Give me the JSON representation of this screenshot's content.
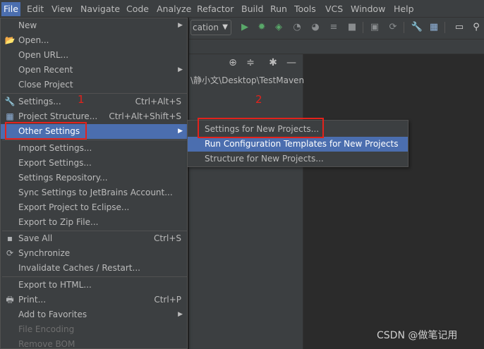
{
  "menubar": {
    "items": [
      "File",
      "Edit",
      "View",
      "Navigate",
      "Code",
      "Analyze",
      "Refactor",
      "Build",
      "Run",
      "Tools",
      "VCS",
      "Window",
      "Help"
    ]
  },
  "toolbar": {
    "run_config": "cation",
    "icons": [
      "run-icon",
      "debug-icon",
      "coverage-icon",
      "profile-icon",
      "attach-icon",
      "step-icon",
      "stop-icon",
      "build-icon",
      "sync-icon",
      "settings-wrench-icon",
      "project-structure-icon",
      "window-icon",
      "search-icon"
    ]
  },
  "project_panel": {
    "path": "\\静小文\\Desktop\\TestMaven"
  },
  "file_menu": {
    "items": [
      {
        "label": "New",
        "icon": "",
        "shortcut": "",
        "arrow": true
      },
      {
        "label": "Open...",
        "icon": "folder-icon",
        "shortcut": "",
        "arrow": false
      },
      {
        "label": "Open URL...",
        "icon": "",
        "shortcut": "",
        "arrow": false
      },
      {
        "label": "Open Recent",
        "icon": "",
        "shortcut": "",
        "arrow": true
      },
      {
        "label": "Close Project",
        "icon": "",
        "shortcut": "",
        "arrow": false
      },
      {
        "label": "Settings...",
        "icon": "wrench-icon",
        "shortcut": "Ctrl+Alt+S",
        "arrow": false
      },
      {
        "label": "Project Structure...",
        "icon": "project-structure-icon",
        "shortcut": "Ctrl+Alt+Shift+S",
        "arrow": false
      },
      {
        "label": "Other Settings",
        "icon": "",
        "shortcut": "",
        "arrow": true
      },
      {
        "label": "Import Settings...",
        "icon": "",
        "shortcut": "",
        "arrow": false
      },
      {
        "label": "Export Settings...",
        "icon": "",
        "shortcut": "",
        "arrow": false
      },
      {
        "label": "Settings Repository...",
        "icon": "",
        "shortcut": "",
        "arrow": false
      },
      {
        "label": "Sync Settings to JetBrains Account...",
        "icon": "",
        "shortcut": "",
        "arrow": false
      },
      {
        "label": "Export Project to Eclipse...",
        "icon": "",
        "shortcut": "",
        "arrow": false
      },
      {
        "label": "Export to Zip File...",
        "icon": "",
        "shortcut": "",
        "arrow": false
      },
      {
        "label": "Save All",
        "icon": "save-icon",
        "shortcut": "Ctrl+S",
        "arrow": false
      },
      {
        "label": "Synchronize",
        "icon": "synchronize-icon",
        "shortcut": "",
        "arrow": false
      },
      {
        "label": "Invalidate Caches / Restart...",
        "icon": "",
        "shortcut": "",
        "arrow": false
      },
      {
        "label": "Export to HTML...",
        "icon": "",
        "shortcut": "",
        "arrow": false
      },
      {
        "label": "Print...",
        "icon": "print-icon",
        "shortcut": "Ctrl+P",
        "arrow": false
      },
      {
        "label": "Add to Favorites",
        "icon": "",
        "shortcut": "",
        "arrow": true
      },
      {
        "label": "File Encoding",
        "icon": "",
        "shortcut": "",
        "arrow": false
      },
      {
        "label": "Remove BOM",
        "icon": "",
        "shortcut": "",
        "arrow": false
      }
    ]
  },
  "other_settings_submenu": {
    "items": [
      "Settings for New Projects...",
      "Run Configuration Templates for New Projects",
      "Structure for New Projects..."
    ]
  },
  "annotations": {
    "step1": "1",
    "step2": "2"
  },
  "watermark": "CSDN @做笔记用",
  "colors": {
    "menu_bg": "#3c3f41",
    "selection": "#4b6eaf",
    "editor_bg": "#2b2b2b",
    "annotation_red": "#e3221c",
    "run_green": "#59a869"
  }
}
